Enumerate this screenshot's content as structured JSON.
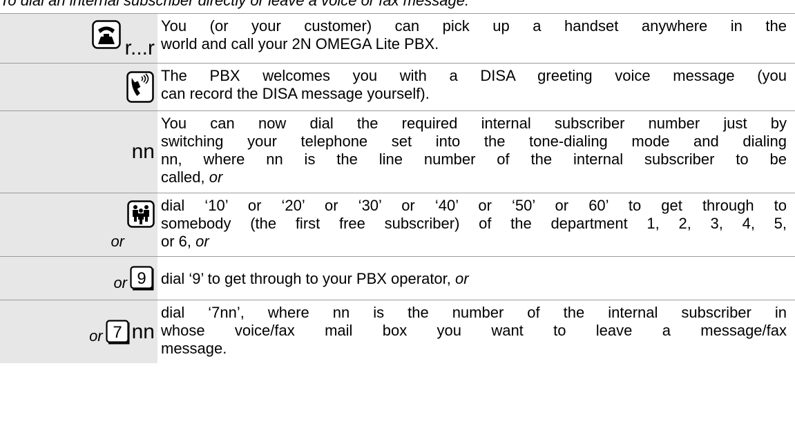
{
  "intro": "To dial an internal subscriber directly or leave a voice or fax message:",
  "rows": [
    {
      "label": "r...r",
      "icon": "phone-handset-icon",
      "lines": [
        "You (or your customer) can pick up a handset anywhere in the",
        "world and call your 2N OMEGA Lite PBX."
      ]
    },
    {
      "label": "",
      "icon": "voice-message-icon",
      "lines": [
        "The PBX welcomes you with a DISA greeting voice message (you",
        "can record the DISA message yourself)."
      ]
    },
    {
      "label": "nn",
      "icon": "",
      "lines": [
        "You can now dial the required internal subscriber number just by",
        "switching your telephone set into the tone-dialing mode and dialing",
        "nn, where nn is the line number of the internal subscriber to be",
        "called,"
      ],
      "tail": "or"
    },
    {
      "or": "or",
      "icon": "department-group-icon",
      "lines": [
        "dial ‘10’ or ‘20’ or ‘30’ or ‘40’ or ‘50’ or 60’ to get through to",
        "somebody (the first free subscriber) of the department 1, 2, 3, 4, 5,",
        "or 6,"
      ],
      "tail": "or"
    },
    {
      "or": "or",
      "key": "9",
      "icon": "key-9-icon",
      "lines": [
        "dial ‘9’ to get through to your PBX operator,"
      ],
      "tail": "or"
    },
    {
      "or": "or",
      "key": "7",
      "label": "nn",
      "icon": "key-7-icon",
      "lines": [
        "dial ‘7nn’, where nn is the number of the internal subscriber in",
        "whose voice/fax mail box you want to leave a message/fax",
        "message."
      ]
    }
  ]
}
